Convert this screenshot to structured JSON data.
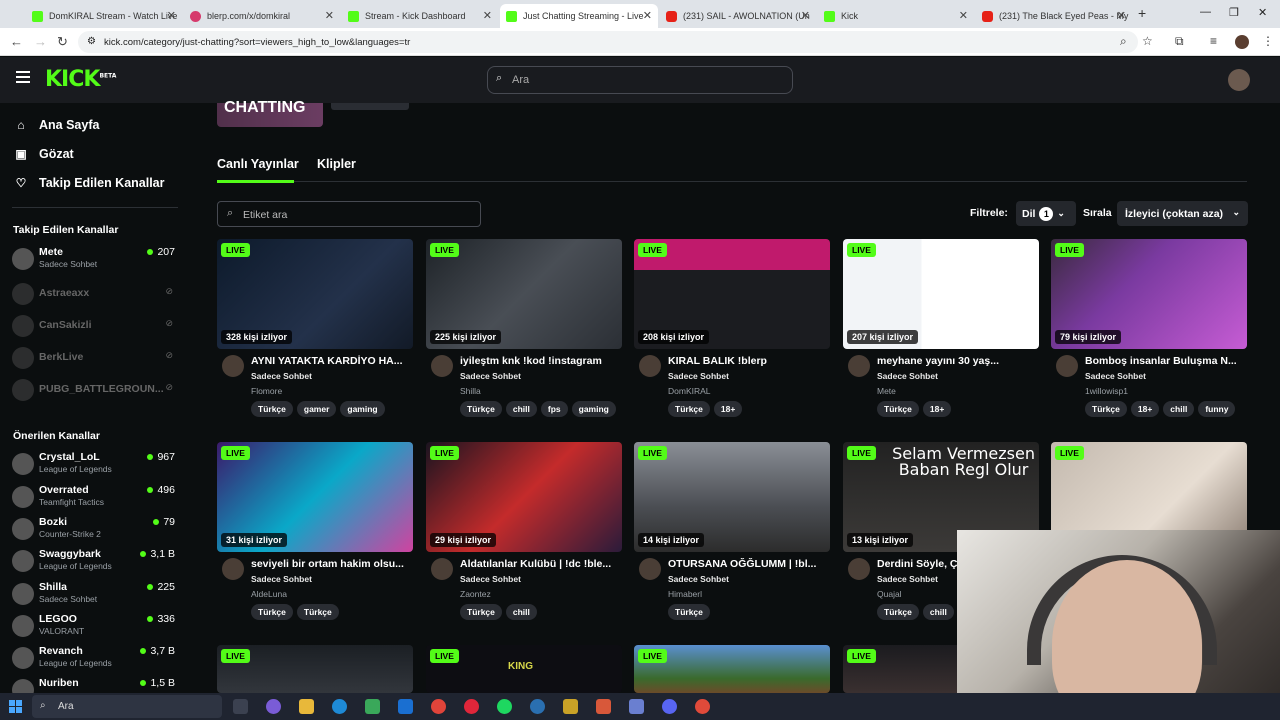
{
  "browser": {
    "tabs": [
      {
        "title": "DomKIRAL Stream - Watch Live",
        "icon": "kick-favicon"
      },
      {
        "title": "blerp.com/x/domkiral",
        "icon": "blerp-favicon"
      },
      {
        "title": "Stream - Kick Dashboard",
        "icon": "kick-favicon"
      },
      {
        "title": "Just Chatting Streaming - Live",
        "icon": "kick-favicon"
      },
      {
        "title": "(231) SAIL - AWOLNATION (Un",
        "icon": "youtube-favicon"
      },
      {
        "title": "Kick",
        "icon": "kick-favicon"
      },
      {
        "title": "(231) The Black Eyed Peas - My",
        "icon": "youtube-favicon"
      }
    ],
    "url": "kick.com/category/just-chatting?sort=viewers_high_to_low&languages=tr"
  },
  "header": {
    "logo": "KICK",
    "logo_badge": "BETA",
    "search_placeholder": "Ara"
  },
  "sidebar": {
    "nav": [
      {
        "label": "Ana Sayfa",
        "icon": "home-icon"
      },
      {
        "label": "Gözat",
        "icon": "browse-icon"
      },
      {
        "label": "Takip Edilen Kanallar",
        "icon": "heart-icon"
      }
    ],
    "followed_title": "Takip Edilen Kanallar",
    "followed": [
      {
        "name": "Mete",
        "category": "Sadece Sohbet",
        "viewers": "207",
        "live": true
      },
      {
        "name": "Astraeaxx",
        "live": false
      },
      {
        "name": "CanSakizli",
        "live": false
      },
      {
        "name": "BerkLive",
        "live": false
      },
      {
        "name": "PUBG_BATTLEGROUN...",
        "live": false
      }
    ],
    "recommended_title": "Önerilen Kanallar",
    "recommended": [
      {
        "name": "Crystal_LoL",
        "category": "League of Legends",
        "viewers": "967"
      },
      {
        "name": "Overrated",
        "category": "Teamfight Tactics",
        "viewers": "496"
      },
      {
        "name": "Bozki",
        "category": "Counter-Strike 2",
        "viewers": "79"
      },
      {
        "name": "Swaggybark",
        "category": "League of Legends",
        "viewers": "3,1 B"
      },
      {
        "name": "Shilla",
        "category": "Sadece Sohbet",
        "viewers": "225"
      },
      {
        "name": "LEGOO",
        "category": "VALORANT",
        "viewers": "336"
      },
      {
        "name": "Revanch",
        "category": "League of Legends",
        "viewers": "3,7 B"
      },
      {
        "name": "Nuriben",
        "category": "",
        "viewers": "1,5 B"
      }
    ]
  },
  "banner": {
    "title": "CHATTING"
  },
  "tabs": {
    "live": "Canlı Yayınlar",
    "clips": "Klipler"
  },
  "filters": {
    "tag_placeholder": "Etiket ara",
    "filter_label": "Filtrele:",
    "lang_label": "Dil",
    "lang_count": "1",
    "sort_label": "Sırala",
    "sort_value": "İzleyici (çoktan aza)"
  },
  "live_badge": "LIVE",
  "streams": [
    {
      "viewers": "328 kişi izliyor",
      "title": "AYNI YATAKTA KARDİYO HA...",
      "category": "Sadece Sohbet",
      "user": "Flomore",
      "tags": [
        "Türkçe",
        "gamer",
        "gaming"
      ]
    },
    {
      "viewers": "225 kişi izliyor",
      "title": "iyileştm knk !kod !instagram",
      "category": "Sadece Sohbet",
      "user": "Shilla",
      "tags": [
        "Türkçe",
        "chill",
        "fps",
        "gaming"
      ]
    },
    {
      "viewers": "208 kişi izliyor",
      "title": "KIRAL BALIK !blerp",
      "category": "Sadece Sohbet",
      "user": "DomKIRAL",
      "tags": [
        "Türkçe",
        "18+"
      ]
    },
    {
      "viewers": "207 kişi izliyor",
      "title": "meyhane yayını 30 yaş...",
      "category": "Sadece Sohbet",
      "user": "Mete",
      "tags": [
        "Türkçe",
        "18+"
      ]
    },
    {
      "viewers": "79 kişi izliyor",
      "title": "Bomboş insanlar Buluşma N...",
      "category": "Sadece Sohbet",
      "user": "1willowisp1",
      "tags": [
        "Türkçe",
        "18+",
        "chill",
        "funny"
      ]
    },
    {
      "viewers": "31 kişi izliyor",
      "title": "seviyeli bir ortam hakim olsu...",
      "category": "Sadece Sohbet",
      "user": "AldeLuna",
      "tags": [
        "Türkçe",
        "Türkçe"
      ]
    },
    {
      "viewers": "29 kişi izliyor",
      "title": "Aldatılanlar Kulübü | !dc !ble...",
      "category": "Sadece Sohbet",
      "user": "Zaontez",
      "tags": [
        "Türkçe",
        "chill"
      ]
    },
    {
      "viewers": "14 kişi izliyor",
      "title": "OTURSANA OĞĞLUMM | !bl...",
      "category": "Sadece Sohbet",
      "user": "Himaberl",
      "tags": [
        "Türkçe"
      ]
    },
    {
      "viewers": "13 kişi izliyor",
      "title": "Derdini Söyle, Ça...",
      "category": "Sadece Sohbet",
      "user": "Quajal",
      "tags": [
        "Türkçe",
        "chill"
      ],
      "overlay": "Selam Vermezsen Baban Regl Olur"
    },
    {
      "viewers": "",
      "title": "",
      "category": "",
      "user": "",
      "tags": []
    }
  ],
  "thumb_overlays": {
    "card9": "Selam Vermezsen",
    "card9b": "Baban Regl Olur",
    "card12": "KING"
  },
  "taskbar": {
    "search": "Ara"
  },
  "colors": {
    "accent": "#53fc18",
    "bg": "#0b0e0f",
    "header": "#191b1f"
  }
}
